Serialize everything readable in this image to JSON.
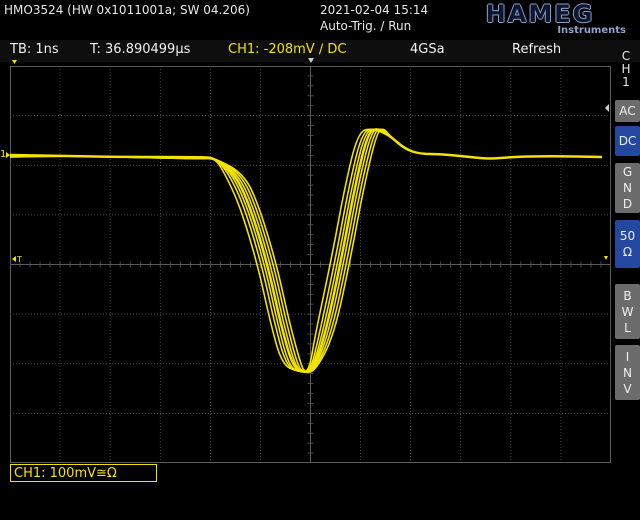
{
  "header": {
    "device": "HMO3524 (HW 0x1011001a; SW 04.206)",
    "datetime": "2021-02-04 15:14",
    "trigger_mode": "Auto-Trig. / Run",
    "logo": "HAMEG",
    "logo_sub": "Instruments"
  },
  "info": {
    "timebase": "TB: 1ns",
    "trigger_time": "T: 36.890499µs",
    "ch1_trigger": "CH1: -208mV ∕ DC",
    "sample_rate": "4GSa",
    "acq_mode": "Refresh"
  },
  "sidebar": {
    "channel_label": "CH1",
    "buttons": [
      {
        "label": "AC",
        "active": false
      },
      {
        "label": "DC",
        "active": true
      },
      {
        "label": "GND",
        "active": false
      },
      {
        "label": "50Ω",
        "active": true
      },
      {
        "label": "BWL",
        "active": false
      },
      {
        "label": "INV",
        "active": false
      }
    ]
  },
  "status": {
    "ch1_scale": "CH1: 100mV≅Ω"
  },
  "markers": {
    "ch1_ground": "1",
    "trigger_level": "T"
  },
  "colors": {
    "trace": "#f2e300",
    "grid": "#5a5a5a",
    "active_button": "#2448a0"
  }
}
